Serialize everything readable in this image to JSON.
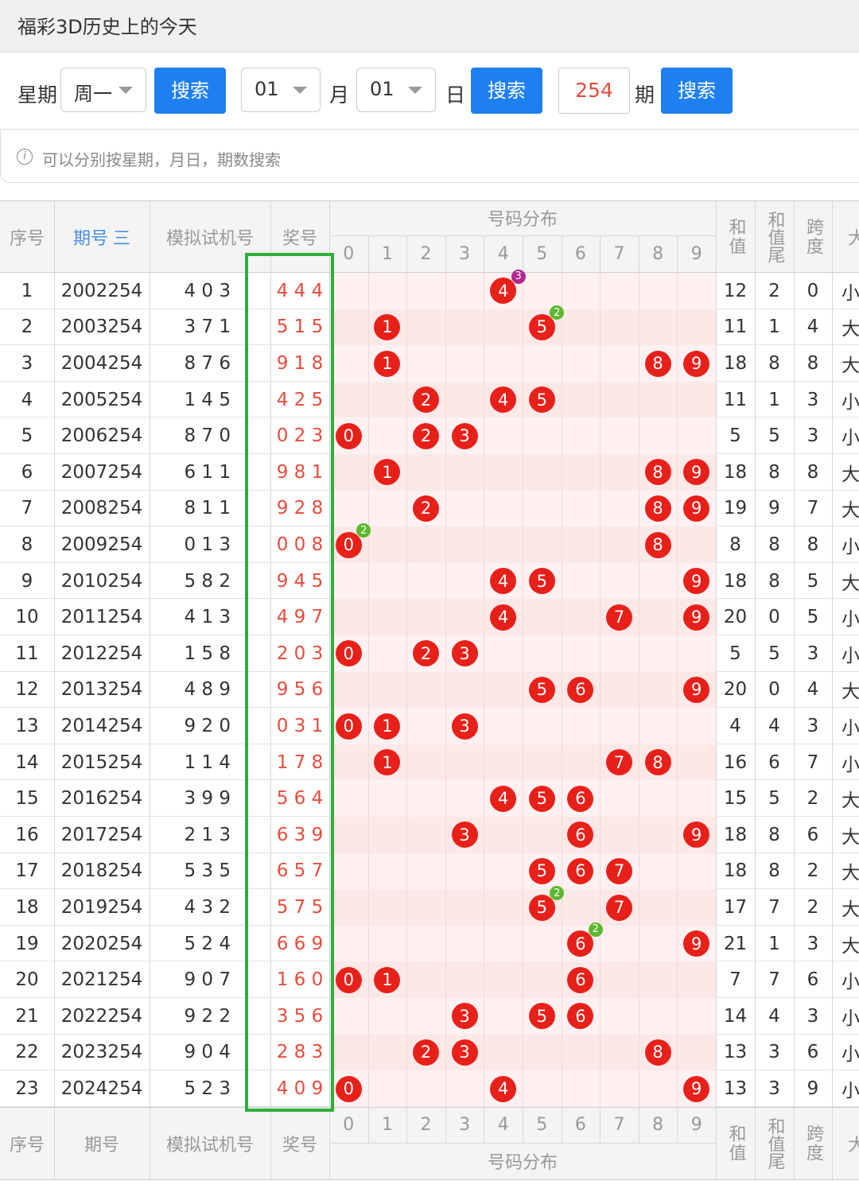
{
  "title": "福彩3D历史上的今天",
  "search": {
    "weekday_label": "星期",
    "weekday_value": "周一",
    "search_button": "搜索",
    "month_value": "01",
    "month_label": "月",
    "day_value": "01",
    "day_label": "日",
    "issue_value": "254",
    "issue_label": "期",
    "hint": "可以分别按星期，月日，期数搜索"
  },
  "table": {
    "headers": {
      "index": "序号",
      "issue": "期号",
      "sort_icon": "三",
      "sim": "模拟试机号",
      "award": "奖号",
      "distribution": "号码分布",
      "sum": "和值",
      "sum_tail": "和值尾",
      "span": "跨度",
      "size": "大"
    },
    "digits": [
      "0",
      "1",
      "2",
      "3",
      "4",
      "5",
      "6",
      "7",
      "8",
      "9"
    ],
    "rows": [
      {
        "idx": "1",
        "issue": "2002254",
        "sim": "4 0 3",
        "award": "4 4 4",
        "sum": "12",
        "tail": "2",
        "span": "0",
        "size": "小"
      },
      {
        "idx": "2",
        "issue": "2003254",
        "sim": "3 7 1",
        "award": "5 1 5",
        "sum": "11",
        "tail": "1",
        "span": "4",
        "size": "大"
      },
      {
        "idx": "3",
        "issue": "2004254",
        "sim": "8 7 6",
        "award": "9 1 8",
        "sum": "18",
        "tail": "8",
        "span": "8",
        "size": "大"
      },
      {
        "idx": "4",
        "issue": "2005254",
        "sim": "1 4 5",
        "award": "4 2 5",
        "sum": "11",
        "tail": "1",
        "span": "3",
        "size": "小"
      },
      {
        "idx": "5",
        "issue": "2006254",
        "sim": "8 7 0",
        "award": "0 2 3",
        "sum": "5",
        "tail": "5",
        "span": "3",
        "size": "小"
      },
      {
        "idx": "6",
        "issue": "2007254",
        "sim": "6 1 1",
        "award": "9 8 1",
        "sum": "18",
        "tail": "8",
        "span": "8",
        "size": "大"
      },
      {
        "idx": "7",
        "issue": "2008254",
        "sim": "8 1 1",
        "award": "9 2 8",
        "sum": "19",
        "tail": "9",
        "span": "7",
        "size": "大"
      },
      {
        "idx": "8",
        "issue": "2009254",
        "sim": "0 1 3",
        "award": "0 0 8",
        "sum": "8",
        "tail": "8",
        "span": "8",
        "size": "小"
      },
      {
        "idx": "9",
        "issue": "2010254",
        "sim": "5 8 2",
        "award": "9 4 5",
        "sum": "18",
        "tail": "8",
        "span": "5",
        "size": "大"
      },
      {
        "idx": "10",
        "issue": "2011254",
        "sim": "4 1 3",
        "award": "4 9 7",
        "sum": "20",
        "tail": "0",
        "span": "5",
        "size": "小"
      },
      {
        "idx": "11",
        "issue": "2012254",
        "sim": "1 5 8",
        "award": "2 0 3",
        "sum": "5",
        "tail": "5",
        "span": "3",
        "size": "小"
      },
      {
        "idx": "12",
        "issue": "2013254",
        "sim": "4 8 9",
        "award": "9 5 6",
        "sum": "20",
        "tail": "0",
        "span": "4",
        "size": "大"
      },
      {
        "idx": "13",
        "issue": "2014254",
        "sim": "9 2 0",
        "award": "0 3 1",
        "sum": "4",
        "tail": "4",
        "span": "3",
        "size": "小"
      },
      {
        "idx": "14",
        "issue": "2015254",
        "sim": "1 1 4",
        "award": "1 7 8",
        "sum": "16",
        "tail": "6",
        "span": "7",
        "size": "小"
      },
      {
        "idx": "15",
        "issue": "2016254",
        "sim": "3 9 9",
        "award": "5 6 4",
        "sum": "15",
        "tail": "5",
        "span": "2",
        "size": "大"
      },
      {
        "idx": "16",
        "issue": "2017254",
        "sim": "2 1 3",
        "award": "6 3 9",
        "sum": "18",
        "tail": "8",
        "span": "6",
        "size": "大"
      },
      {
        "idx": "17",
        "issue": "2018254",
        "sim": "5 3 5",
        "award": "6 5 7",
        "sum": "18",
        "tail": "8",
        "span": "2",
        "size": "大"
      },
      {
        "idx": "18",
        "issue": "2019254",
        "sim": "4 3 2",
        "award": "5 7 5",
        "sum": "17",
        "tail": "7",
        "span": "2",
        "size": "大"
      },
      {
        "idx": "19",
        "issue": "2020254",
        "sim": "5 2 4",
        "award": "6 6 9",
        "sum": "21",
        "tail": "1",
        "span": "3",
        "size": "大"
      },
      {
        "idx": "20",
        "issue": "2021254",
        "sim": "9 0 7",
        "award": "1 6 0",
        "sum": "7",
        "tail": "7",
        "span": "6",
        "size": "小"
      },
      {
        "idx": "21",
        "issue": "2022254",
        "sim": "9 2 2",
        "award": "3 5 6",
        "sum": "14",
        "tail": "4",
        "span": "3",
        "size": "小"
      },
      {
        "idx": "22",
        "issue": "2023254",
        "sim": "9 0 4",
        "award": "2 8 3",
        "sum": "13",
        "tail": "3",
        "span": "6",
        "size": "小"
      },
      {
        "idx": "23",
        "issue": "2024254",
        "sim": "5 2 3",
        "award": "4 0 9",
        "sum": "13",
        "tail": "3",
        "span": "9",
        "size": "小"
      }
    ]
  },
  "colors": {
    "ball": "#e8201a",
    "repeat_badge_2": "#5cb82e",
    "repeat_badge_3": "#b0288e",
    "highlight_box": "#2fae3c",
    "accent": "#1e7ff0"
  }
}
